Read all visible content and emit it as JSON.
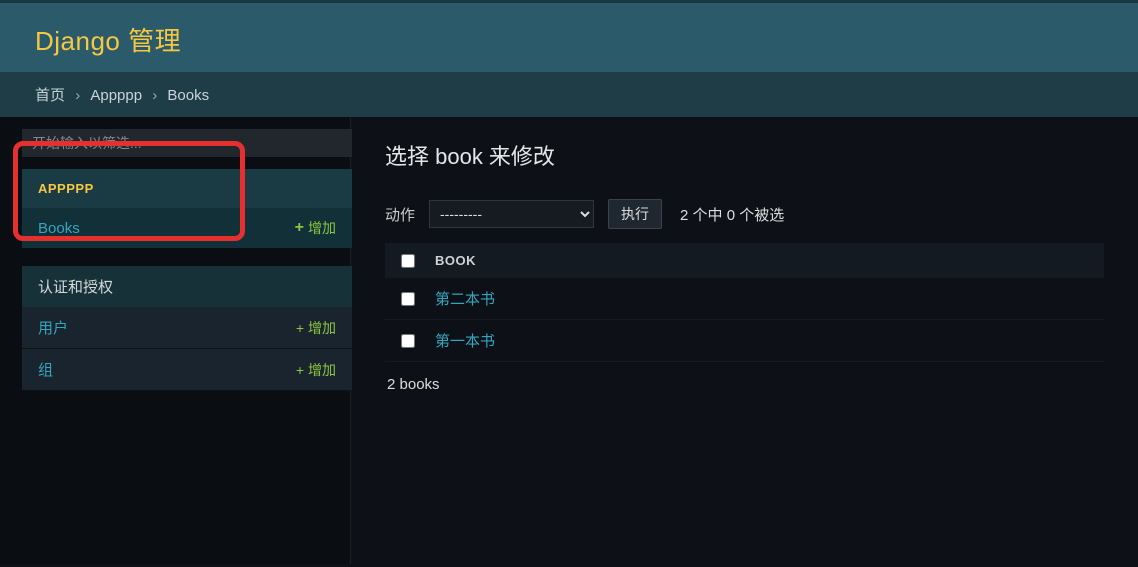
{
  "header": {
    "title": "Django 管理"
  },
  "breadcrumbs": {
    "home": "首页",
    "app": "Appppp",
    "model": "Books",
    "sep": "›"
  },
  "sidebar": {
    "filter_placeholder": "开始输入以筛选...",
    "app_group": {
      "caption": "APPPPP",
      "items": [
        {
          "label": "Books",
          "add_label": "增加"
        }
      ]
    },
    "auth_group": {
      "caption": "认证和授权",
      "items": [
        {
          "label": "用户",
          "add_label": "增加"
        },
        {
          "label": "组",
          "add_label": "增加"
        }
      ]
    }
  },
  "main": {
    "title": "选择 book 来修改",
    "actions": {
      "label": "动作",
      "placeholder_option": "---------",
      "go": "执行",
      "selection_count": "2 个中 0 个被选"
    },
    "table": {
      "column": "BOOK",
      "rows": [
        {
          "title": "第二本书"
        },
        {
          "title": "第一本书"
        }
      ]
    },
    "paginator": "2 books"
  }
}
